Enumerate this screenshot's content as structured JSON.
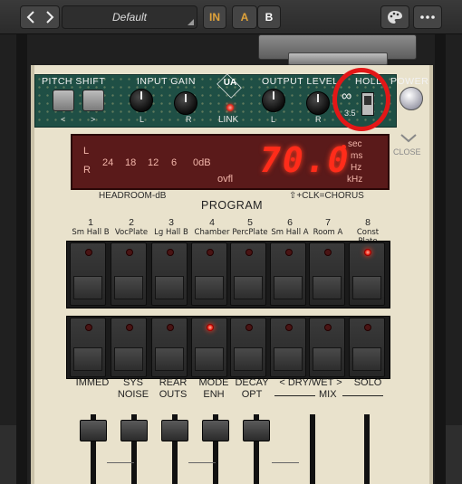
{
  "toolbar": {
    "preset_name": "Default",
    "in_label": "IN",
    "a_label": "A",
    "b_label": "B",
    "accent": "#e0a33a"
  },
  "controls": {
    "pitch_shift_label": "PITCH SHIFT",
    "pitch_left": "<",
    "pitch_right": ">",
    "input_gain_label": "INPUT GAIN",
    "output_level_label": "OUTPUT LEVEL",
    "left_label": "L",
    "right_label": "R",
    "link_label": "LINK",
    "hold_label": "HOLD",
    "hold_infinity": "∞",
    "hold_value": "3.5",
    "power_label": "POWER",
    "logo": "UA"
  },
  "display": {
    "channel_l": "L",
    "channel_r": "R",
    "meter_scale": [
      "24",
      "18",
      "12",
      "6",
      "0dB"
    ],
    "overflow": "ovfl",
    "value": "70.0",
    "units": [
      "sec",
      "ms",
      "Hz",
      "kHz"
    ],
    "close_label": "CLOSE",
    "headroom_label": "HEADROOM-dB",
    "chorus_label": "⇧+CLK=CHORUS"
  },
  "program": {
    "title": "PROGRAM",
    "items": [
      {
        "num": "1",
        "name": "Sm Hall B",
        "led_top": false,
        "led_bottom": false
      },
      {
        "num": "2",
        "name": "VocPlate",
        "led_top": false,
        "led_bottom": false
      },
      {
        "num": "3",
        "name": "Lg Hall B",
        "led_top": false,
        "led_bottom": false
      },
      {
        "num": "4",
        "name": "Chamber",
        "led_top": false,
        "led_bottom": true
      },
      {
        "num": "5",
        "name": "PercPlate",
        "led_top": false,
        "led_bottom": false
      },
      {
        "num": "6",
        "name": "Sm Hall A",
        "led_top": false,
        "led_bottom": false
      },
      {
        "num": "7",
        "name": "Room A",
        "led_top": false,
        "led_bottom": false
      },
      {
        "num": "8",
        "name": "Const Plate",
        "led_top": true,
        "led_bottom": false
      }
    ]
  },
  "functions": {
    "immed": "IMMED",
    "sys_noise_1": "SYS",
    "sys_noise_2": "NOISE",
    "rear_outs_1": "REAR",
    "rear_outs_2": "OUTS",
    "mode_enh_1": "MODE",
    "mode_enh_2": "ENH",
    "decay_opt_1": "DECAY",
    "decay_opt_2": "OPT",
    "dry_wet": "< DRY/WET >",
    "solo": "SOLO",
    "mix": "MIX"
  }
}
